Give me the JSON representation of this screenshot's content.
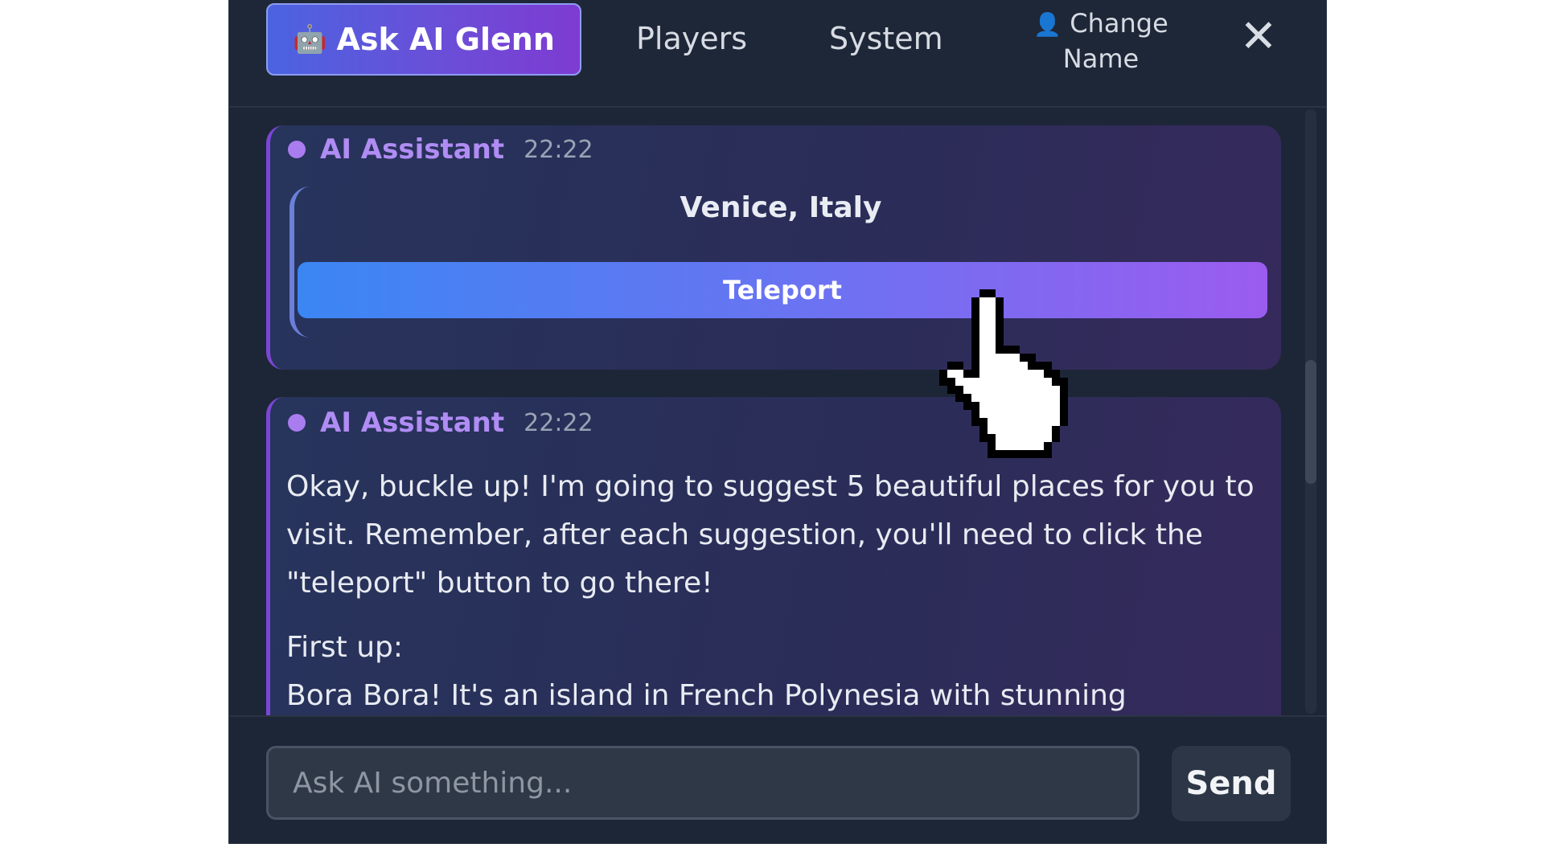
{
  "tabs": {
    "active": {
      "icon": "🤖",
      "label": "Ask AI Glenn"
    },
    "players": "Players",
    "system": "System",
    "change_name": {
      "icon": "👤",
      "line1": "Change",
      "line2": "Name"
    },
    "close": "✕"
  },
  "messages": [
    {
      "sender": "AI Assistant",
      "time": "22:22",
      "card": {
        "title": "Venice, Italy",
        "button": "Teleport"
      }
    },
    {
      "sender": "AI Assistant",
      "time": "22:22",
      "paragraph1": "Okay, buckle up! I'm going to suggest 5 beautiful places for you to visit. Remember, after each suggestion, you'll need to click the \"teleport\" button to go there!",
      "paragraph2_line1": "First up:",
      "paragraph2_line2": "Bora Bora! It's an island in French Polynesia with stunning turquoise"
    }
  ],
  "input": {
    "placeholder": "Ask AI something...",
    "value": ""
  },
  "send_label": "Send",
  "colors": {
    "panel_bg": "#1d2636",
    "accent_purple": "#7e3bd2",
    "accent_blue": "#3b86f3",
    "sender_color": "#b08cf4"
  },
  "cursor_icon": "hand-pointer-icon"
}
